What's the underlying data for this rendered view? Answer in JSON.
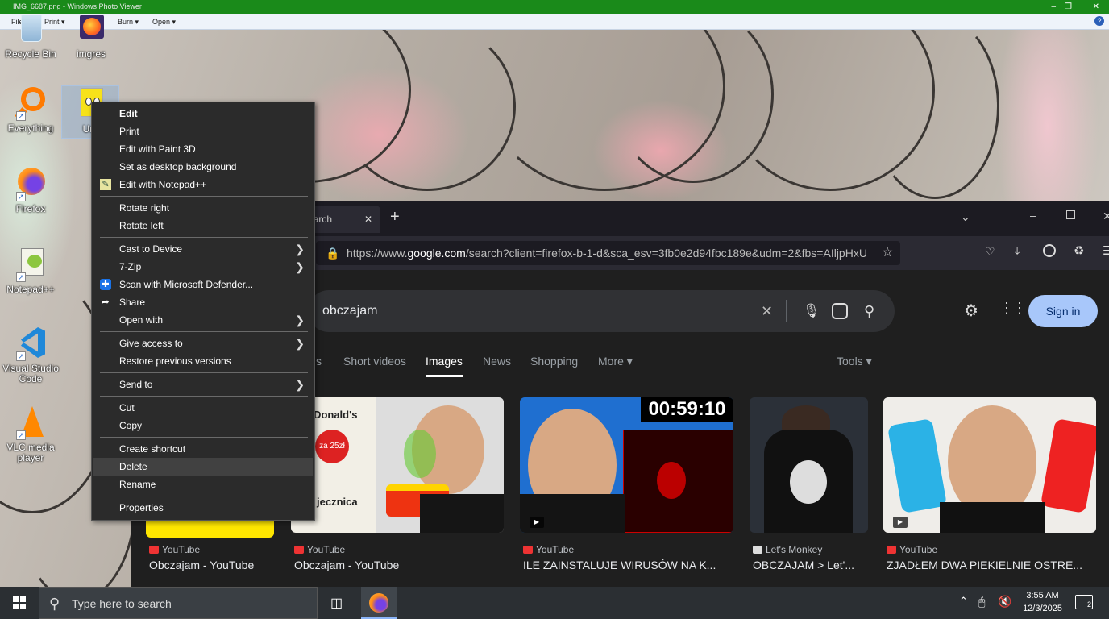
{
  "photo_viewer": {
    "title": "IMG_6687.png - Windows Photo Viewer",
    "menu": {
      "file": "File",
      "print": "Print",
      "burn": "Burn",
      "open": "Open"
    }
  },
  "desktop": {
    "icons": [
      {
        "label": "Recycle Bin"
      },
      {
        "label": "imgres"
      },
      {
        "label": "Everything"
      },
      {
        "label": "Unt"
      },
      {
        "label": "Firefox"
      },
      {
        "label": "Notepad++"
      },
      {
        "label": "Visual Studio Code"
      },
      {
        "label": "VLC media player"
      }
    ]
  },
  "context_menu": {
    "items": [
      {
        "label": "Edit"
      },
      {
        "label": "Print"
      },
      {
        "label": "Edit with Paint 3D"
      },
      {
        "label": "Set as desktop background"
      },
      {
        "label": "Edit with Notepad++"
      },
      {
        "label": "Rotate right"
      },
      {
        "label": "Rotate left"
      },
      {
        "label": "Cast to Device"
      },
      {
        "label": "7-Zip"
      },
      {
        "label": "Scan with Microsoft Defender..."
      },
      {
        "label": "Share"
      },
      {
        "label": "Open with"
      },
      {
        "label": "Give access to"
      },
      {
        "label": "Restore previous versions"
      },
      {
        "label": "Send to"
      },
      {
        "label": "Cut"
      },
      {
        "label": "Copy"
      },
      {
        "label": "Create shortcut"
      },
      {
        "label": "Delete"
      },
      {
        "label": "Rename"
      },
      {
        "label": "Properties"
      }
    ]
  },
  "browser": {
    "tab_title": "earch",
    "url_prefix": "https://www.",
    "url_domain": "google.com",
    "url_rest": "/search?client=firefox-b-1-d&sca_esv=3fb0e2d94fbc189e&udm=2&fbs=AIljpHxU",
    "search_query": "obczajam",
    "sign_in": "Sign in",
    "tabs": [
      "s",
      "Short videos",
      "Images",
      "News",
      "Shopping",
      "More",
      "Tools"
    ],
    "thumb_texts": {
      "mcd": "McDonald's",
      "price": "za 25zł",
      "jecznica": "jecznica",
      "timer": "00:59:10"
    },
    "results": [
      {
        "source": "YouTube",
        "title": "Obczajam - YouTube"
      },
      {
        "source": "YouTube",
        "title": "Obczajam - YouTube"
      },
      {
        "source": "YouTube",
        "title": "ILE ZAINSTALUJE WIRUSÓW NA K..."
      },
      {
        "source": "Let's Monkey",
        "title": "OBCZAJAM > Let'..."
      },
      {
        "source": "YouTube",
        "title": "ZJADŁEM DWA PIEKIELNIE OSTRE..."
      }
    ]
  },
  "taskbar": {
    "search_placeholder": "Type here to search",
    "time": "3:55 AM",
    "date": "12/3/2025",
    "notifications": "2"
  }
}
